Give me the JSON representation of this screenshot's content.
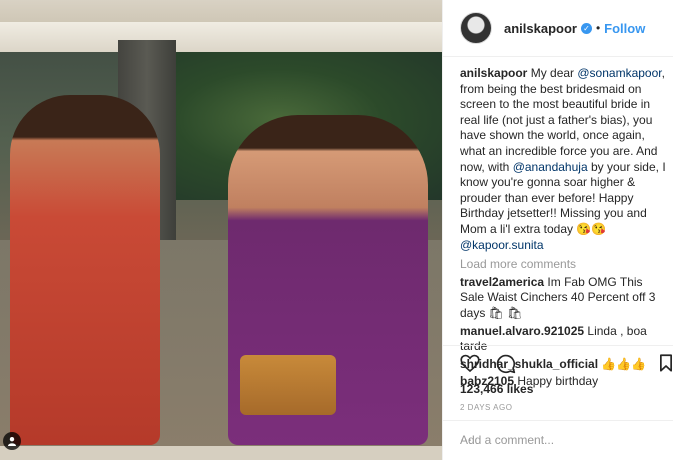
{
  "post": {
    "username": "anilskapoor",
    "follow_label": "Follow",
    "dot": "•",
    "verified_glyph": "✓"
  },
  "caption": {
    "username": "anilskapoor",
    "part1": " My dear ",
    "mention1": "@sonamkapoor",
    "part2": ", from being the best bridesmaid on screen to the most beautiful bride in real life (not just a father's bias), you have shown the world, once again, what an incredible force you are. And now, with ",
    "mention2": "@anandahuja",
    "part3": " by your side, I know you're gonna soar higher & prouder than ever before! Happy Birthday jetsetter!! Missing you and Mom a li'l extra today 😘😘",
    "mention3": "@kapoor.sunita"
  },
  "load_more": "Load more comments",
  "comments": [
    {
      "user": "travel2america",
      "text": " Im Fab OMG This Sale Waist Cinchers 40 Percent off 3 days 🛍 🛍"
    },
    {
      "user": "manuel.alvaro.921025",
      "text": " Linda , boa tarde"
    },
    {
      "user": "shridhar_shukla_official",
      "text": " 👍👍👍"
    },
    {
      "user": "babz2105",
      "text": " Happy birthday"
    }
  ],
  "likes": "123,466 likes",
  "date": "2 DAYS AGO",
  "add_comment_placeholder": "Add a comment...",
  "more_glyph": "⋯",
  "icons": [
    "heart-icon",
    "comment-icon",
    "bookmark-icon",
    "user-tag-icon",
    "more-icon"
  ],
  "colors": {
    "accent": "#3897f0",
    "text": "#262626",
    "muted": "#999999",
    "mention": "#003569"
  }
}
